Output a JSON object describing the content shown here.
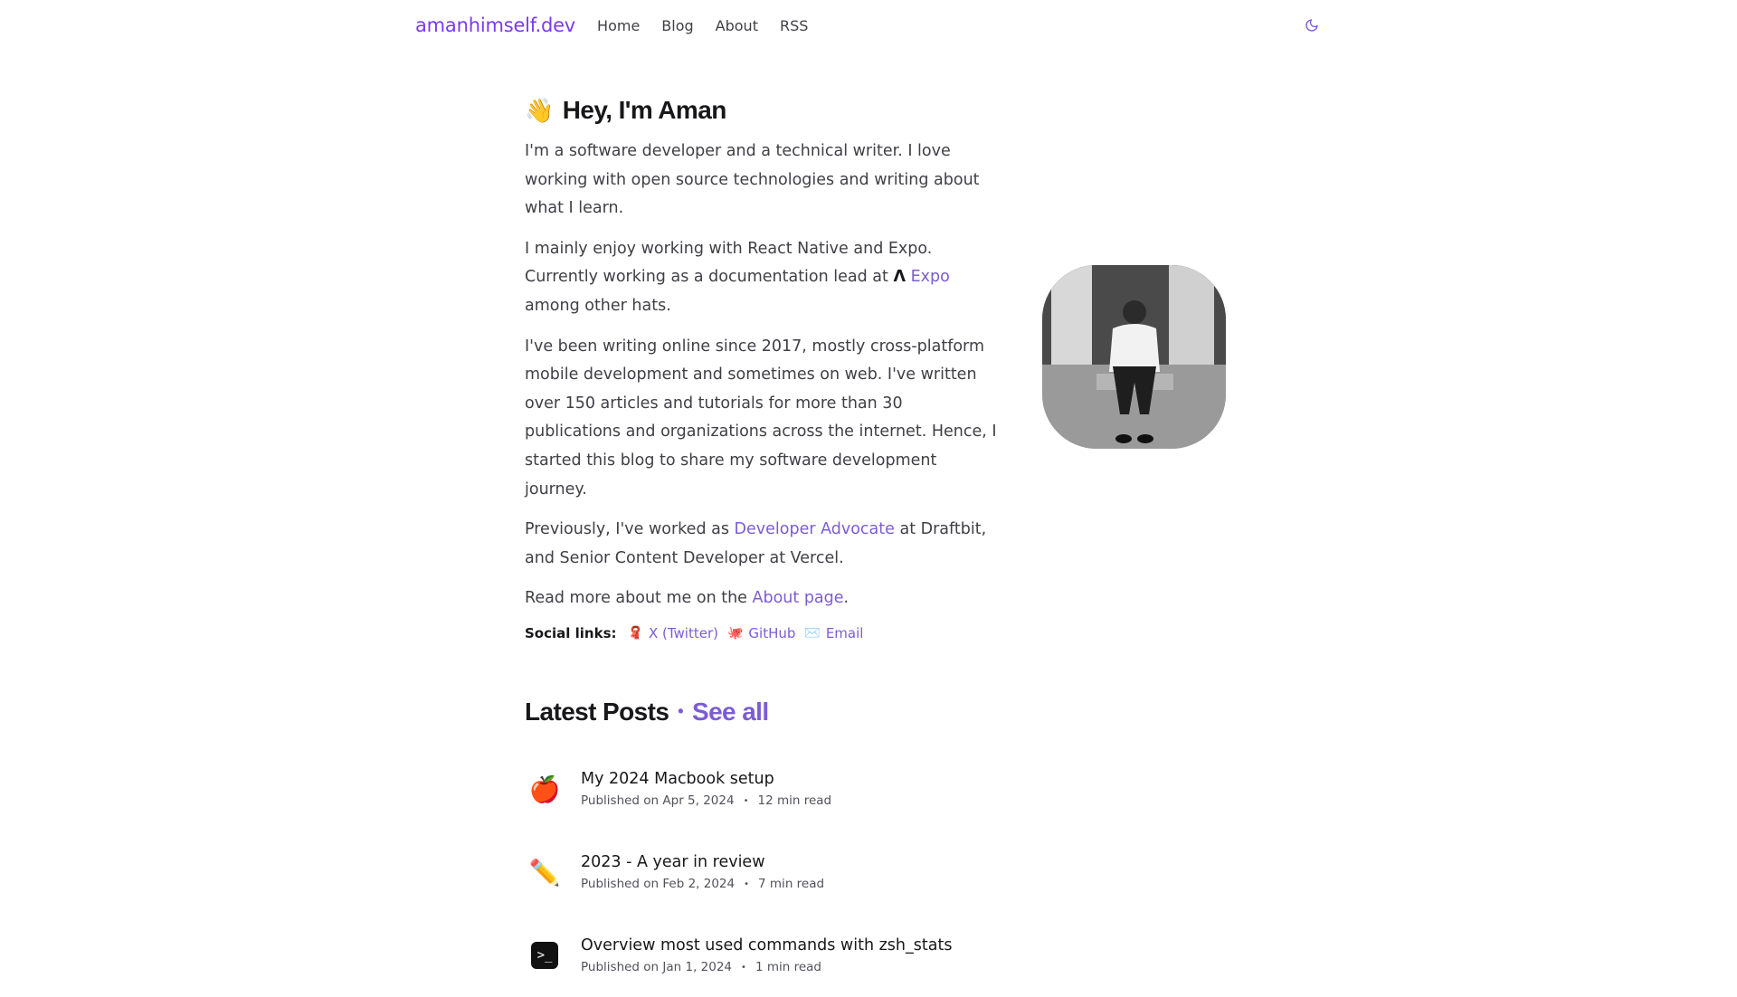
{
  "header": {
    "brand": "amanhimself.dev",
    "nav": [
      "Home",
      "Blog",
      "About",
      "RSS"
    ]
  },
  "hero": {
    "wave_emoji": "👋",
    "title": "Hey, I'm Aman",
    "p1": "I'm a software developer and a technical writer. I love working with open source technologies and writing about what I learn.",
    "p2_before": "I mainly enjoy working with React Native and Expo. Currently working as a documentation lead at ",
    "p2_lambda": "Λ",
    "p2_link": "Expo",
    "p2_after": " among other hats.",
    "p3": "I've been writing online since 2017, mostly cross-platform mobile development and sometimes on web. I've written over 150 articles and tutorials for more than 30 publications and organizations across the internet. Hence, I started this blog to share my software development journey.",
    "p4_before": "Previously, I've worked as ",
    "p4_link": "Developer Advocate",
    "p4_after": " at Draftbit, and Senior Content Developer at Vercel.",
    "p5_before": "Read more about me on the ",
    "p5_link": "About page",
    "p5_after": "."
  },
  "social": {
    "label": "Social links:",
    "links": [
      {
        "label": "X (Twitter)",
        "icon": "🧣"
      },
      {
        "label": "GitHub",
        "icon": "🐙"
      },
      {
        "label": "Email",
        "icon": "✉️"
      }
    ]
  },
  "posts": {
    "title": "Latest Posts",
    "separator": "•",
    "see_all": "See all",
    "items": [
      {
        "icon": "🍎",
        "title": "My 2024 Macbook setup",
        "date": "Published on Apr 5, 2024",
        "read": "12 min read"
      },
      {
        "icon": "✏️",
        "title": "2023 - A year in review",
        "date": "Published on Feb 2, 2024",
        "read": "7 min read"
      },
      {
        "icon": ">_",
        "title": "Overview most used commands with zsh_stats",
        "date": "Published on Jan 1, 2024",
        "read": "1 min read"
      }
    ],
    "meta_sep": "•"
  },
  "colors": {
    "accent": "#7c3aed",
    "link": "#7c5cd6",
    "text": "#3f3f46",
    "heading": "#18181b"
  },
  "icons": {
    "theme_toggle": "moon-icon"
  }
}
